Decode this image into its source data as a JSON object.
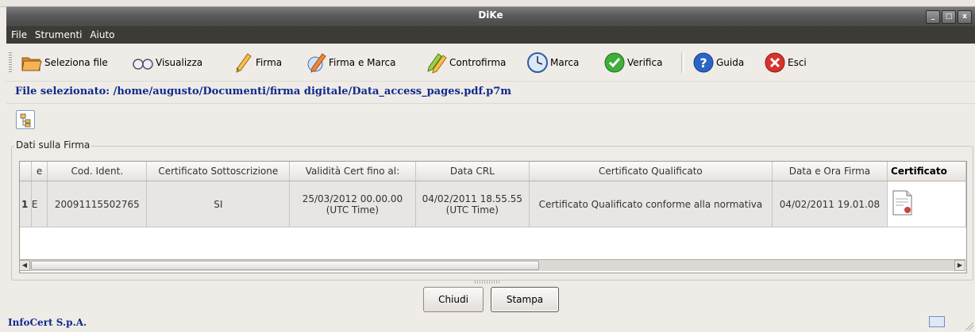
{
  "window": {
    "title": "DiKe",
    "controls": [
      "_",
      "□",
      "x"
    ]
  },
  "menu": [
    "File",
    "Strumenti",
    "Aiuto"
  ],
  "toolbar": {
    "seleziona": "Seleziona file",
    "visualizza": "Visualizza",
    "firma": "Firma",
    "firma_marca": "Firma e Marca",
    "controfirma": "Controfirma",
    "marca": "Marca",
    "verifica": "Verifica",
    "guida": "Guida",
    "esci": "Esci"
  },
  "file_selected": "File selezionato: /home/augusto/Documenti/firma digitale/Data_access_pages.pdf.p7m",
  "frame_label": "Dati sulla Firma",
  "table": {
    "headers": [
      "",
      "e",
      "Cod. Ident.",
      "Certificato Sottoscrizione",
      "Validità Cert fino al:",
      "Data CRL",
      "Certificato Qualificato",
      "Data e Ora Firma",
      "Certificato"
    ],
    "row": {
      "num": "1",
      "e": "E",
      "cod": "20091115502765",
      "sottoscrizione": "SI",
      "validita_1": "25/03/2012  00.00.00",
      "validita_2": "(UTC Time)",
      "crl_1": "04/02/2011  18.55.55",
      "crl_2": "(UTC Time)",
      "qualificato": "Certificato Qualificato conforme alla normativa",
      "data_ora": "04/02/2011  19.01.08"
    }
  },
  "buttons": {
    "chiudi": "Chiudi",
    "stampa": "Stampa"
  },
  "footer": "InfoCert S.p.A."
}
